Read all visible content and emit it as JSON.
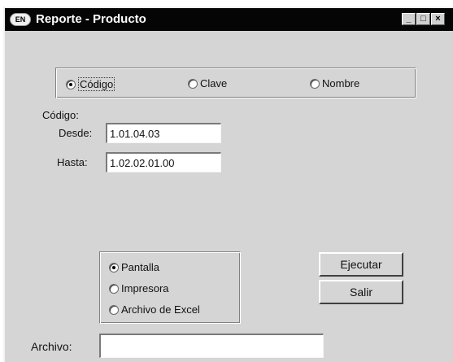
{
  "window": {
    "title": "Reporte - Producto",
    "icon_text": "EN",
    "controls": {
      "minimize": "_",
      "maximize": "□",
      "close": "×"
    }
  },
  "criteria": {
    "options": [
      {
        "label": "Código",
        "selected": true
      },
      {
        "label": "Clave",
        "selected": false
      },
      {
        "label": "Nombre",
        "selected": false
      }
    ]
  },
  "range": {
    "section_label": "Código:",
    "from_label": "Desde:",
    "from_value": "1.01.04.03",
    "to_label": "Hasta:",
    "to_value": "1.02.02.01.00"
  },
  "output": {
    "options": [
      {
        "label": "Pantalla",
        "selected": true
      },
      {
        "label": "Impresora",
        "selected": false
      },
      {
        "label": "Archivo de Excel",
        "selected": false
      }
    ]
  },
  "buttons": {
    "execute": "Ejecutar",
    "exit": "Salir"
  },
  "file": {
    "label": "Archivo:",
    "value": ""
  }
}
